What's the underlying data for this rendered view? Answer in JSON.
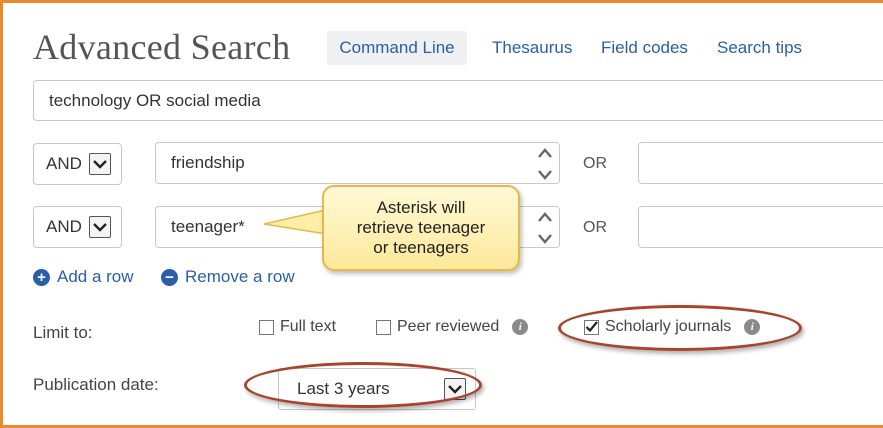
{
  "header": {
    "title": "Advanced Search",
    "nav": {
      "command_line": "Command Line",
      "thesaurus": "Thesaurus",
      "field_codes": "Field codes",
      "search_tips": "Search tips"
    }
  },
  "search": {
    "main_query": "technology OR social media",
    "rows": [
      {
        "operator": "AND",
        "term": "friendship",
        "or_label": "OR",
        "or_value": ""
      },
      {
        "operator": "AND",
        "term": "teenager*",
        "or_label": "OR",
        "or_value": ""
      }
    ],
    "add_row": "Add a row",
    "remove_row": "Remove a row"
  },
  "callout": {
    "line1": "Asterisk will",
    "line2": "retrieve teenager",
    "line3": "or teenagers"
  },
  "limit": {
    "label": "Limit to:",
    "full_text": "Full text",
    "full_text_checked": false,
    "peer_reviewed": "Peer reviewed",
    "peer_reviewed_checked": false,
    "scholarly_journals": "Scholarly journals",
    "scholarly_journals_checked": true
  },
  "publication_date": {
    "label": "Publication date:",
    "selected": "Last 3 years"
  },
  "colors": {
    "frame": "#e88a2d",
    "link": "#2a5ea8",
    "ellipse": "#a8432d",
    "callout_fill": "#fde89a"
  }
}
